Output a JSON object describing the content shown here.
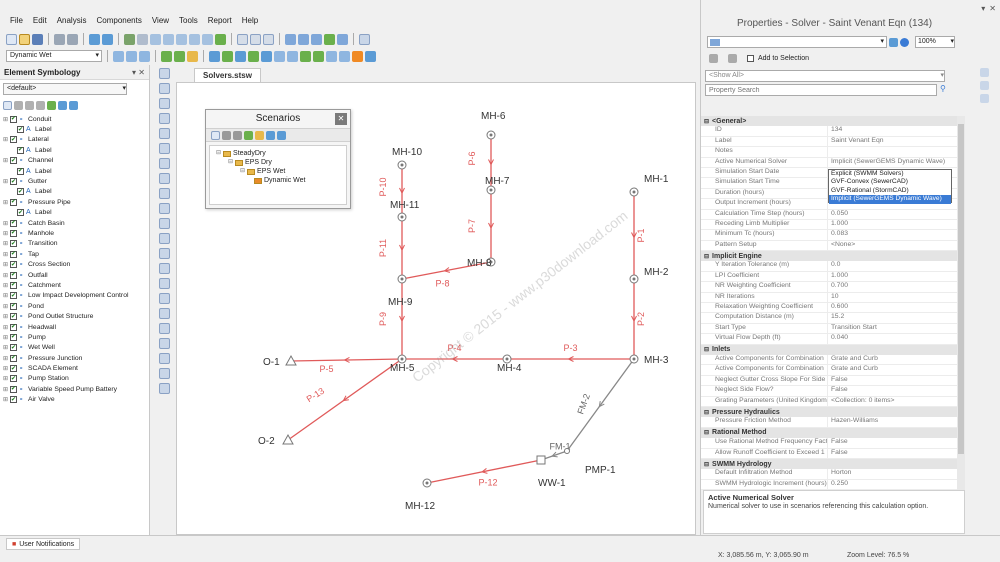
{
  "menu": [
    "File",
    "Edit",
    "Analysis",
    "Components",
    "View",
    "Tools",
    "Report",
    "Help"
  ],
  "scenario_combo": "Dynamic Wet",
  "left_panel": {
    "title": "Element Symbology",
    "filter": "<default>",
    "items": [
      {
        "label": "Conduit",
        "level": 0
      },
      {
        "label": "Label",
        "level": 1
      },
      {
        "label": "Lateral",
        "level": 0
      },
      {
        "label": "Label",
        "level": 1
      },
      {
        "label": "Channel",
        "level": 0
      },
      {
        "label": "Label",
        "level": 1
      },
      {
        "label": "Gutter",
        "level": 0
      },
      {
        "label": "Label",
        "level": 1
      },
      {
        "label": "Pressure Pipe",
        "level": 0
      },
      {
        "label": "Label",
        "level": 1
      },
      {
        "label": "Catch Basin",
        "level": 0
      },
      {
        "label": "Manhole",
        "level": 0
      },
      {
        "label": "Transition",
        "level": 0
      },
      {
        "label": "Tap",
        "level": 0
      },
      {
        "label": "Cross Section",
        "level": 0
      },
      {
        "label": "Outfall",
        "level": 0
      },
      {
        "label": "Catchment",
        "level": 0
      },
      {
        "label": "Low Impact Development Control",
        "level": 0
      },
      {
        "label": "Pond",
        "level": 0
      },
      {
        "label": "Pond Outlet Structure",
        "level": 0
      },
      {
        "label": "Headwall",
        "level": 0
      },
      {
        "label": "Pump",
        "level": 0
      },
      {
        "label": "Wet Well",
        "level": 0
      },
      {
        "label": "Pressure Junction",
        "level": 0
      },
      {
        "label": "SCADA Element",
        "level": 0
      },
      {
        "label": "Pump Station",
        "level": 0
      },
      {
        "label": "Variable Speed Pump Battery",
        "level": 0
      },
      {
        "label": "Air Valve",
        "level": 0
      }
    ]
  },
  "doc_tab": "Solvers.stsw",
  "scenarios": {
    "title": "Scenarios",
    "tree": [
      {
        "label": "SteadyDry",
        "level": 0,
        "type": "folder"
      },
      {
        "label": "EPS Dry",
        "level": 1,
        "type": "folder"
      },
      {
        "label": "EPS Wet",
        "level": 2,
        "type": "folder"
      },
      {
        "label": "Dynamic Wet",
        "level": 3,
        "type": "checked"
      }
    ]
  },
  "network": {
    "nodes": [
      {
        "id": "MH-10",
        "shape": "mh"
      },
      {
        "id": "MH-6",
        "shape": "mh"
      },
      {
        "id": "MH-7",
        "shape": "mh"
      },
      {
        "id": "MH-11",
        "shape": "mh"
      },
      {
        "id": "MH-8",
        "shape": "mh"
      },
      {
        "id": "MH-9",
        "shape": "mh"
      },
      {
        "id": "MH-1",
        "shape": "mh"
      },
      {
        "id": "MH-2",
        "shape": "mh"
      },
      {
        "id": "MH-3",
        "shape": "mh"
      },
      {
        "id": "MH-4",
        "shape": "mh"
      },
      {
        "id": "MH-5",
        "shape": "mh"
      },
      {
        "id": "O-1",
        "shape": "outfall"
      },
      {
        "id": "O-2",
        "shape": "outfall"
      },
      {
        "id": "MH-12",
        "shape": "mh"
      },
      {
        "id": "WW-1",
        "shape": "ww"
      },
      {
        "id": "PMP-1",
        "shape": "pump"
      }
    ],
    "pipes": [
      "P-10",
      "P-11",
      "P-9",
      "P-6",
      "P-7",
      "P-8",
      "P-1",
      "P-2",
      "P-3",
      "P-4",
      "P-5",
      "P-13",
      "P-12",
      "FM-1",
      "FM-2"
    ]
  },
  "watermark": "Copyright © 2015 - www.p30download.com",
  "properties": {
    "title": "Properties - Solver - Saint Venant Eqn (134)",
    "zoom": "100%",
    "add_to_selection": "Add to Selection",
    "show_all": "<Show All>",
    "search_placeholder": "Property Search",
    "rows": [
      {
        "type": "cat",
        "label": "<General>"
      },
      {
        "key": "ID",
        "value": "134"
      },
      {
        "key": "Label",
        "value": "Saint Venant Eqn"
      },
      {
        "key": "Notes",
        "value": ""
      },
      {
        "key": "Active Numerical Solver",
        "value": "Implicit (SewerGEMS Dynamic Wave)"
      },
      {
        "key": "Simulation Start Date",
        "value": ""
      },
      {
        "key": "Simulation Start Time",
        "value": ""
      },
      {
        "key": "Duration (hours)",
        "value": ""
      },
      {
        "key": "Output Increment (hours)",
        "value": "0.050"
      },
      {
        "key": "Calculation Time Step (hours)",
        "value": "0.050"
      },
      {
        "key": "Receding Limb Multiplier",
        "value": "1.000"
      },
      {
        "key": "Minimum Tc (hours)",
        "value": "0.083"
      },
      {
        "key": "Pattern Setup",
        "value": "<None>"
      },
      {
        "type": "cat",
        "label": "Implicit Engine"
      },
      {
        "key": "Y Iteration Tolerance (m)",
        "value": "0.0"
      },
      {
        "key": "LPI Coefficient",
        "value": "1.000"
      },
      {
        "key": "NR Weighting Coefficient",
        "value": "0.700"
      },
      {
        "key": "NR Iterations",
        "value": "10"
      },
      {
        "key": "Relaxation Weighting Coefficient",
        "value": "0.600"
      },
      {
        "key": "Computation Distance (m)",
        "value": "15.2"
      },
      {
        "key": "Start Type",
        "value": "Transition Start"
      },
      {
        "key": "Virtual Flow Depth (ft)",
        "value": "0.040"
      },
      {
        "type": "cat",
        "label": "Inlets"
      },
      {
        "key": "Active Components for Combination",
        "value": "Grate and Curb"
      },
      {
        "key": "Active Components for Combination",
        "value": "Grate and Curb"
      },
      {
        "key": "Neglect Gutter Cross Slope For Side",
        "value": "False"
      },
      {
        "key": "Neglect Side Flow?",
        "value": "False"
      },
      {
        "key": "Grating Parameters (United Kingdom)",
        "value": "<Collection: 0 items>"
      },
      {
        "type": "cat",
        "label": "Pressure Hydraulics"
      },
      {
        "key": "Pressure Friction Method",
        "value": "Hazen-Williams"
      },
      {
        "type": "cat",
        "label": "Rational Method"
      },
      {
        "key": "Use Rational Method Frequency Factor",
        "value": "False"
      },
      {
        "key": "Allow Runoff Coefficient to Exceed 1",
        "value": "False"
      },
      {
        "type": "cat",
        "label": "SWMM Hydrology"
      },
      {
        "key": "Default Infiltration Method",
        "value": "Horton"
      },
      {
        "key": "SWMM Hydrologic Increment (hours)",
        "value": "0.250"
      }
    ],
    "solver_options": [
      "Explicit (SWMM Solvers)",
      "GVF-Convex (SewerCAD)",
      "GVF-Rational (StormCAD)",
      "Implicit (SewerGEMS Dynamic Wave)"
    ],
    "solver_selected": 3,
    "desc_title": "Active Numerical Solver",
    "desc_text": "Numerical solver to use in scenarios referencing this calculation option."
  },
  "statusbar": {
    "notifications": "User Notifications",
    "coords": "X: 3,085.56 m, Y: 3,065.90 m",
    "zoom": "Zoom Level: 76.5 %"
  },
  "colors": {
    "pipe": "#e05a5a",
    "node": "#777777",
    "accent": "#3a7bd5"
  }
}
